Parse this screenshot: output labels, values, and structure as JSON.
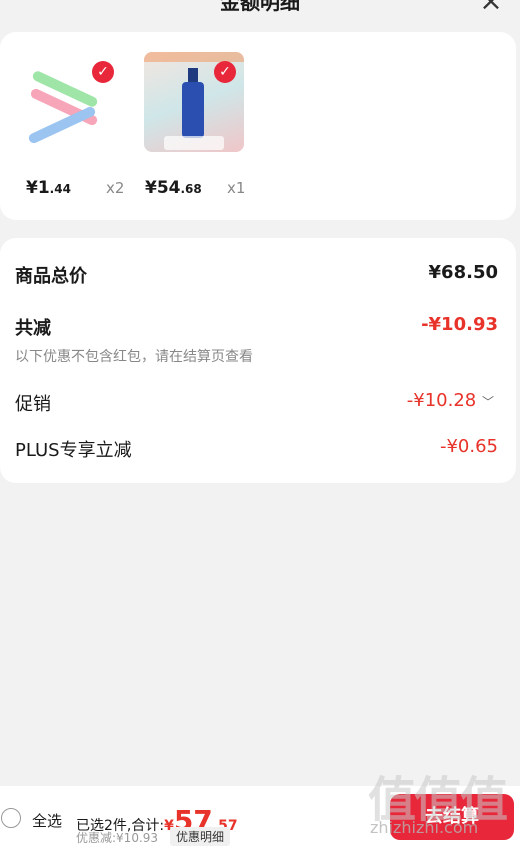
{
  "header": {
    "title": "金额明细",
    "close_icon": "×"
  },
  "products": [
    {
      "price_int": "¥1",
      "price_dec": ".44",
      "qty": "x2"
    },
    {
      "price_int": "¥54",
      "price_dec": ".68",
      "qty": "x1"
    }
  ],
  "summary": {
    "total_label": "商品总价",
    "total_value": "¥68.50",
    "reduce_label": "共减",
    "reduce_value": "-¥10.93",
    "note": "以下优惠不包含红包，请在结算页查看",
    "promo_label": "促销",
    "promo_value": "-¥10.28",
    "plus_label": "PLUS专享立减",
    "plus_value": "-¥0.65"
  },
  "bottom": {
    "select_all": "全选",
    "selected_text": "已选2件,合计:",
    "currency": "¥",
    "total_int": "57",
    "total_dec": ".57",
    "discount": "优惠减:¥10.93",
    "detail": "优惠明细",
    "checkout": "去结算"
  },
  "colors": {
    "accent": "#e8273a",
    "price_red": "#e8332a"
  },
  "watermark": {
    "mark": "值值值",
    "url": "zhizhizhi.com"
  }
}
